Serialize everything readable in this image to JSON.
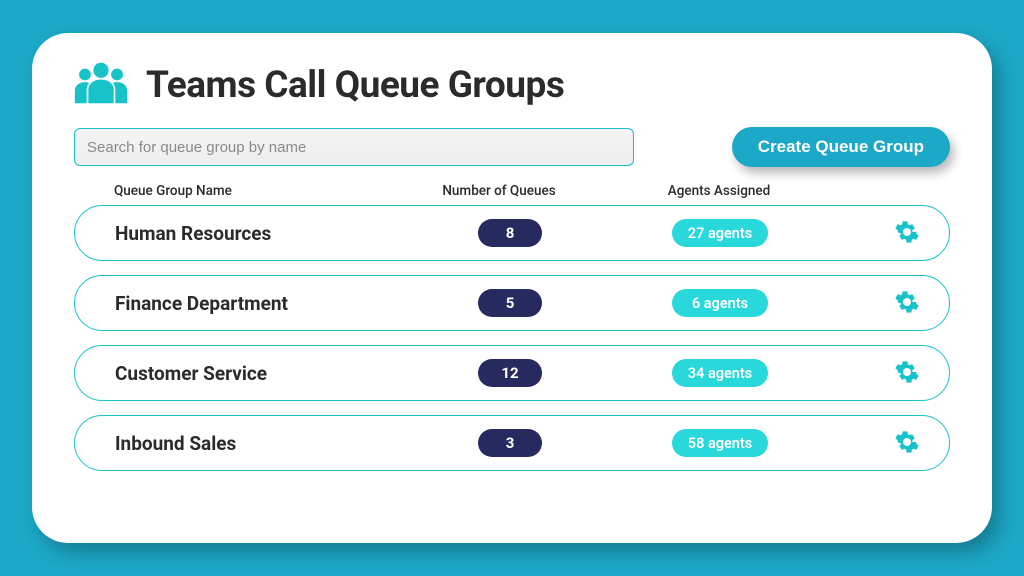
{
  "header": {
    "title": "Teams Call Queue Groups"
  },
  "search": {
    "placeholder": "Search for queue group by name"
  },
  "create_button": {
    "label": "Create Queue Group"
  },
  "columns": {
    "name": "Queue Group Name",
    "queues": "Number of Queues",
    "agents": "Agents Assigned"
  },
  "rows": [
    {
      "name": "Human Resources",
      "queues": "8",
      "agents": "27 agents"
    },
    {
      "name": "Finance Department",
      "queues": "5",
      "agents": "6 agents"
    },
    {
      "name": "Customer Service",
      "queues": "12",
      "agents": "34 agents"
    },
    {
      "name": "Inbound Sales",
      "queues": "3",
      "agents": "58 agents"
    }
  ]
}
